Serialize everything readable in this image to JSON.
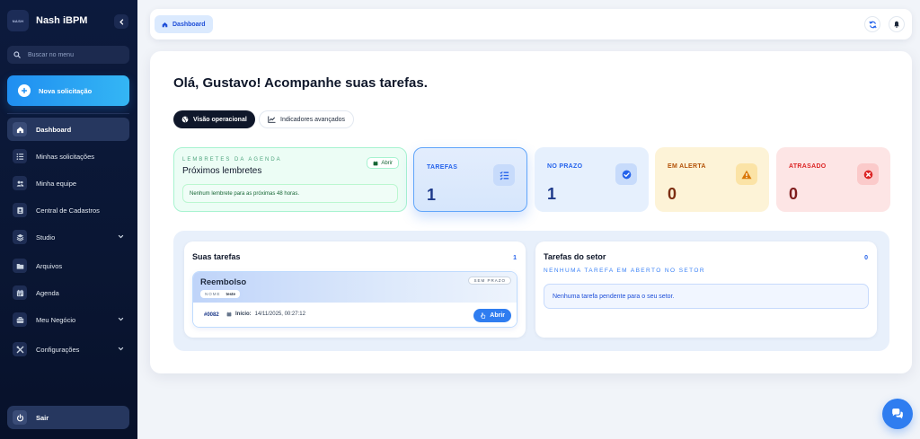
{
  "brand": {
    "logo_text": "NASH",
    "name": "Nash iBPM"
  },
  "sidebar": {
    "search_placeholder": "Buscar no menu",
    "new_request_label": "Nova solicitação",
    "items": [
      {
        "label": "Dashboard",
        "icon": "home-icon",
        "active": true
      },
      {
        "label": "Minhas solicitações",
        "icon": "list-icon"
      },
      {
        "label": "Minha equipe",
        "icon": "users-icon"
      },
      {
        "label": "Central de Cadastros",
        "icon": "address-book-icon"
      },
      {
        "label": "Studio",
        "icon": "layers-icon",
        "expandable": true
      },
      {
        "label": "Arquivos",
        "icon": "folder-icon"
      },
      {
        "label": "Agenda",
        "icon": "calendar-icon"
      },
      {
        "label": "Meu Negócio",
        "icon": "briefcase-icon",
        "expandable": true
      },
      {
        "label": "Configurações",
        "icon": "tools-icon",
        "expandable": true
      }
    ],
    "logout_label": "Sair"
  },
  "topbar": {
    "breadcrumb": "Dashboard"
  },
  "main": {
    "greeting": "Olá, Gustavo! Acompanhe suas tarefas.",
    "tabs": [
      {
        "label": "Visão operacional",
        "active": true
      },
      {
        "label": "Indicadores avançados",
        "active": false
      }
    ],
    "reminders": {
      "overline": "LEMBRETES DA AGENDA",
      "title": "Próximos lembretes",
      "open_label": "Abrir",
      "empty_text": "Nenhum lembrete para as próximas 48 horas."
    },
    "stats": [
      {
        "label": "TAREFAS",
        "value": "1",
        "color": "#2563eb"
      },
      {
        "label": "NO PRAZO",
        "value": "1",
        "color": "#2563eb"
      },
      {
        "label": "EM ALERTA",
        "value": "0",
        "color": "#b45309"
      },
      {
        "label": "ATRASADO",
        "value": "0",
        "color": "#dc2626"
      }
    ],
    "my_tasks": {
      "title": "Suas tarefas",
      "count": "1",
      "task": {
        "name": "Reembolso",
        "tag_key": "NOME",
        "tag_value": "teste",
        "badge": "SEM PRAZO",
        "id": "#0082",
        "start_label": "Início:",
        "start_value": "14/11/2025, 00:27:12",
        "open_label": "Abrir"
      }
    },
    "sector_tasks": {
      "title": "Tarefas do setor",
      "count": "0",
      "subtitle": "NENHUMA TAREFA EM ABERTO NO SETOR",
      "empty_text": "Nenhuma tarefa pendente para o seu setor."
    }
  }
}
